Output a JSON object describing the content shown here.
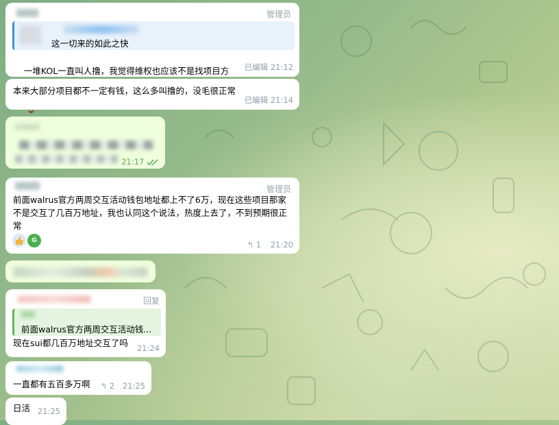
{
  "messages": [
    {
      "role": "管理员",
      "quote_text": "这一切来的如此之快",
      "text": "一堆KOL一直叫人撸，我觉得维权也应该不是找项目方",
      "edited": "已编辑",
      "time": "21:12"
    },
    {
      "text": "本来大部分项目都不一定有钱，这么多叫撸的，没毛很正常",
      "edited": "已编辑",
      "time": "21:14"
    },
    {
      "time": "21:17"
    },
    {
      "role": "管理员",
      "text": "前面walrus官方两周交互活动钱包地址都上不了6万，现在这些项目那家不是交互了几百万地址，我也认同这个说法，热度上去了，不到预期很正常",
      "reactions": [
        {
          "icon": "thumbs-up-icon"
        },
        {
          "icon": "sticker-icon",
          "label": "G"
        }
      ],
      "reply_count": "1",
      "time": "21:20"
    },
    {},
    {
      "role": "回复",
      "quote_text": "前面walrus官方两周交互活动钱...",
      "text": "现在sui都几百万地址交互了吗",
      "time": "21:24"
    },
    {
      "text": "一直都有五百多万啊",
      "reply_count": "2",
      "time": "21:25"
    },
    {
      "text": "日活",
      "time": "21:25"
    }
  ],
  "colors": {
    "accent": "#3d8ede",
    "green": "#5fb55a",
    "meta": "#8ea0a9"
  }
}
